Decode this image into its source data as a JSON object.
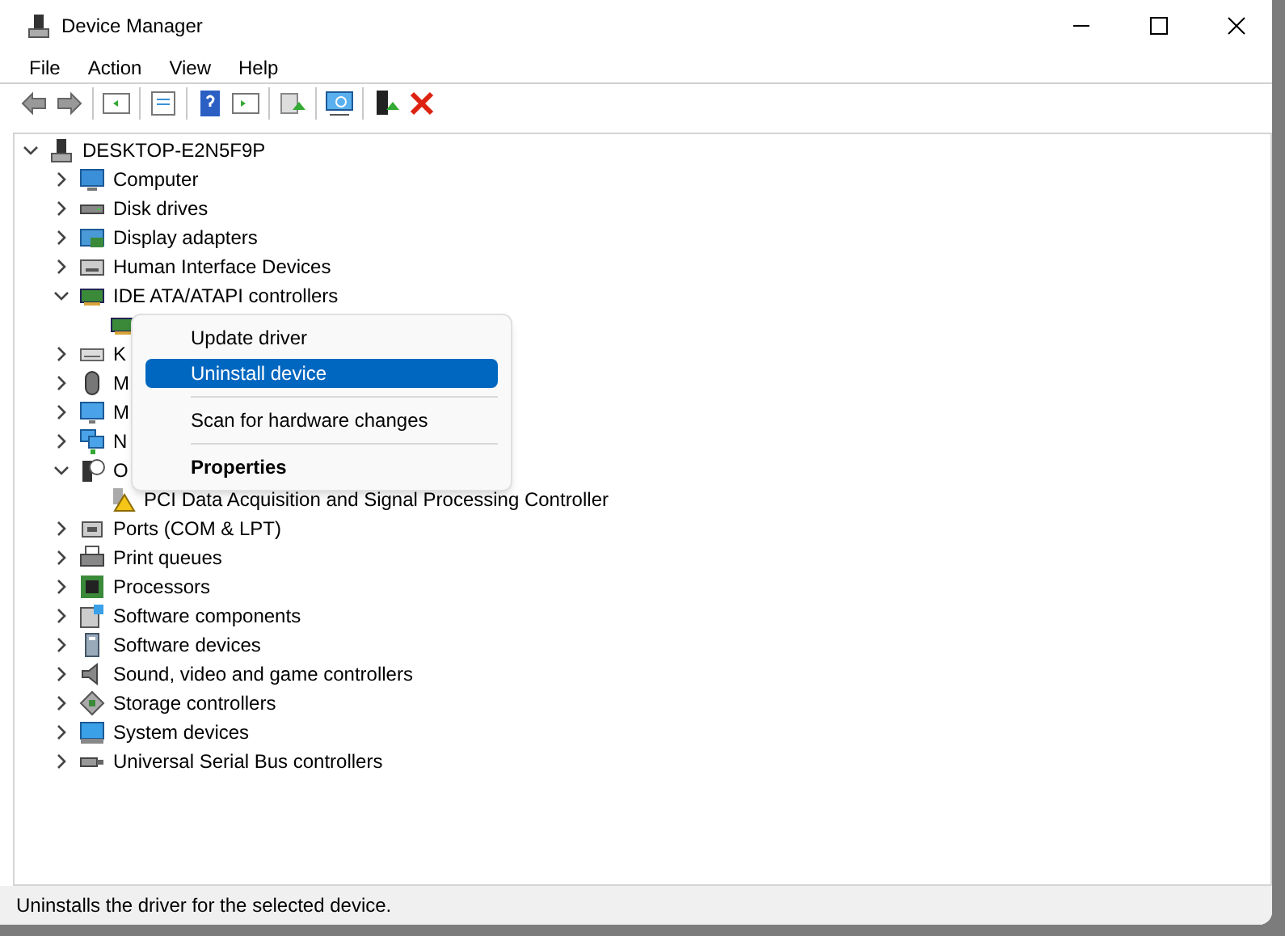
{
  "window": {
    "title": "Device Manager"
  },
  "menu": [
    "File",
    "Action",
    "View",
    "Help"
  ],
  "tree": {
    "label": "DESKTOP-E2N5F9P",
    "kind": "root",
    "expanded": true,
    "children": [
      {
        "label": "Computer",
        "kind": "computer",
        "expanded": false
      },
      {
        "label": "Disk drives",
        "kind": "disk",
        "expanded": false
      },
      {
        "label": "Display adapters",
        "kind": "display",
        "expanded": false
      },
      {
        "label": "Human Interface Devices",
        "kind": "hid",
        "expanded": false
      },
      {
        "label": "IDE ATA/ATAPI controllers",
        "kind": "card",
        "expanded": true,
        "children": [
          {
            "kind": "card"
          }
        ]
      },
      {
        "label": "K",
        "kind": "keyboard",
        "expanded": false
      },
      {
        "label": "M",
        "kind": "mouse",
        "expanded": false
      },
      {
        "label": "M",
        "kind": "monitor",
        "expanded": false
      },
      {
        "label": "N",
        "kind": "network",
        "expanded": false
      },
      {
        "label": "O",
        "kind": "unknown",
        "expanded": true,
        "children": [
          {
            "label": "PCI Data Acquisition and Signal Processing Controller",
            "kind": "warning"
          }
        ]
      },
      {
        "label": "Ports (COM & LPT)",
        "kind": "port",
        "expanded": false
      },
      {
        "label": "Print queues",
        "kind": "printer",
        "expanded": false
      },
      {
        "label": "Processors",
        "kind": "chip",
        "expanded": false
      },
      {
        "label": "Software components",
        "kind": "puzzle",
        "expanded": false
      },
      {
        "label": "Software devices",
        "kind": "software",
        "expanded": false
      },
      {
        "label": "Sound, video and game controllers",
        "kind": "speaker",
        "expanded": false
      },
      {
        "label": "Storage controllers",
        "kind": "storage",
        "expanded": false
      },
      {
        "label": "System devices",
        "kind": "system",
        "expanded": false
      },
      {
        "label": "Universal Serial Bus controllers",
        "kind": "usb",
        "expanded": false
      }
    ]
  },
  "context_menu": [
    {
      "kind": "item",
      "label": "Update driver",
      "selected": false
    },
    {
      "kind": "item",
      "label": "Uninstall device",
      "selected": true
    },
    {
      "kind": "separator"
    },
    {
      "kind": "item",
      "label": "Scan for hardware changes",
      "selected": false
    },
    {
      "kind": "separator"
    },
    {
      "kind": "default",
      "label": "Properties",
      "selected": false
    }
  ],
  "status_bar": "Uninstalls the driver for the selected device."
}
